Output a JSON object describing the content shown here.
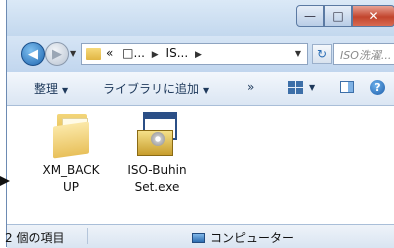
{
  "window": {
    "controls": {
      "minimize": "—",
      "maximize": "□",
      "close": "✕"
    }
  },
  "address": {
    "history_arrow": "▼",
    "crumbs": [
      "«",
      "□...",
      "IS..."
    ],
    "dropdown_arrow": "▼",
    "refresh": "↻",
    "search_placeholder": "ISO洗濯..."
  },
  "toolbar": {
    "organize": "整理",
    "add_to_library": "ライブラリに追加",
    "more": "»",
    "dropdown_arrow": "▼"
  },
  "files": [
    {
      "name": "XM_BACK\nUP",
      "icon": "folder-icon"
    },
    {
      "name": "ISO-Buhin\nSet.exe",
      "icon": "installer-exe-icon"
    }
  ],
  "status": {
    "item_count": "2 個の項目",
    "location": "コンピューター"
  },
  "colors": {
    "frame": "#cfe0f1",
    "close_button": "#c2452d",
    "accent": "#2d6db0"
  }
}
